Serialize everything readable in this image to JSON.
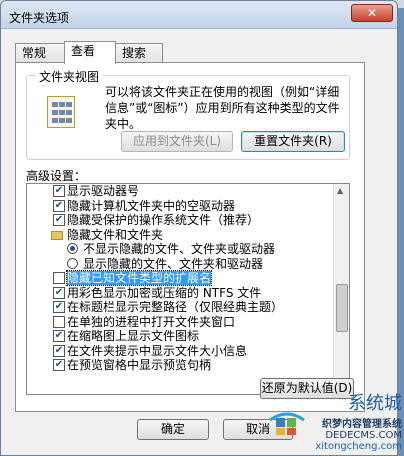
{
  "window": {
    "title": "文件夹选项",
    "close_label": "✕"
  },
  "tabs": [
    {
      "label": "常规"
    },
    {
      "label": "查看"
    },
    {
      "label": "搜索"
    }
  ],
  "folder_views": {
    "group_label": "文件夹视图",
    "description": "可以将该文件夹正在使用的视图（例如“详细信息”或“图标”）应用到所有这种类型的文件夹中。",
    "apply_button": "应用到文件夹(L)",
    "reset_button": "重置文件夹(R)"
  },
  "advanced": {
    "label": "高级设置：",
    "items": [
      {
        "kind": "checkbox",
        "checked": true,
        "label": "显示驱动器号"
      },
      {
        "kind": "checkbox",
        "checked": true,
        "label": "隐藏计算机文件夹中的空驱动器"
      },
      {
        "kind": "checkbox",
        "checked": true,
        "label": "隐藏受保护的操作系统文件（推荐）"
      },
      {
        "kind": "folder",
        "label": "隐藏文件和文件夹"
      },
      {
        "kind": "radio",
        "checked": true,
        "label": "不显示隐藏的文件、文件夹或驱动器"
      },
      {
        "kind": "radio",
        "checked": false,
        "label": "显示隐藏的文件、文件夹和驱动器"
      },
      {
        "kind": "checkbox",
        "checked": false,
        "label": "隐藏已知文件类型的扩展名",
        "highlight": true
      },
      {
        "kind": "checkbox",
        "checked": true,
        "label": "用彩色显示加密或压缩的 NTFS 文件"
      },
      {
        "kind": "checkbox",
        "checked": true,
        "label": "在标题栏显示完整路径（仅限经典主题）"
      },
      {
        "kind": "checkbox",
        "checked": false,
        "label": "在单独的进程中打开文件夹窗口"
      },
      {
        "kind": "checkbox",
        "checked": true,
        "label": "在缩略图上显示文件图标"
      },
      {
        "kind": "checkbox",
        "checked": true,
        "label": "在文件夹提示中显示文件大小信息"
      },
      {
        "kind": "checkbox",
        "checked": true,
        "label": "在预览窗格中显示预览句柄"
      }
    ],
    "restore_button": "还原为默认值(D)"
  },
  "footer": {
    "ok_label": "确定",
    "cancel_label": "取消"
  },
  "watermark": {
    "title": "系统城",
    "line1": "织梦内容管理系统",
    "line2": "DEDECMS.COM",
    "line3": "xitongcheng.com"
  }
}
